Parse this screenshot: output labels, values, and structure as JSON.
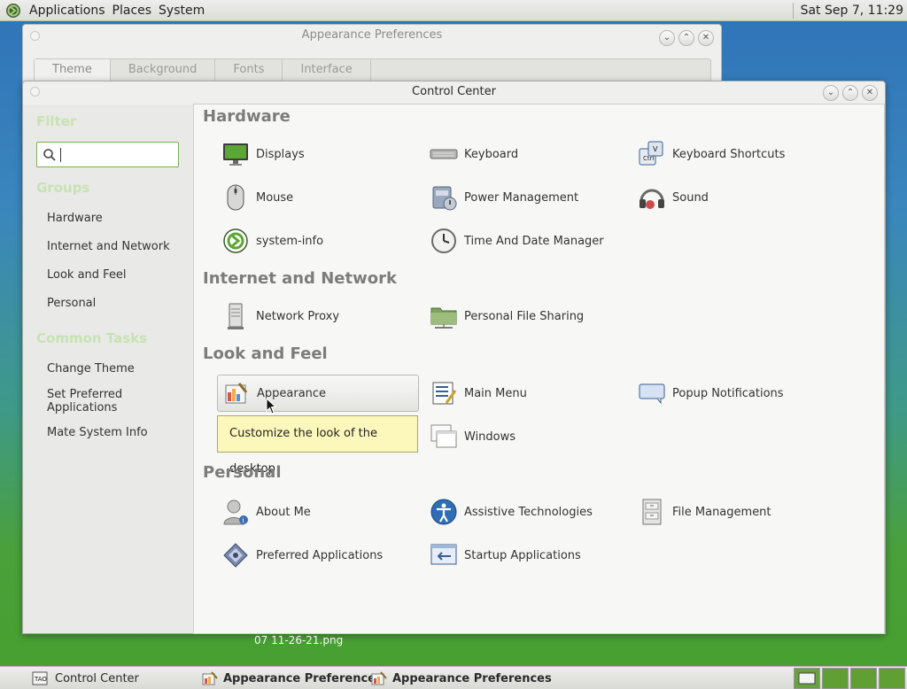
{
  "top_panel": {
    "menus": [
      "Applications",
      "Places",
      "System"
    ],
    "clock": "Sat Sep  7, 11:29"
  },
  "appearance_window": {
    "title": "Appearance Preferences",
    "tabs": [
      "Theme",
      "Background",
      "Fonts",
      "Interface"
    ]
  },
  "control_center": {
    "title": "Control Center",
    "sidebar": {
      "filter_heading": "Filter",
      "search_value": "",
      "groups_heading": "Groups",
      "groups": [
        "Hardware",
        "Internet and Network",
        "Look and Feel",
        "Personal"
      ],
      "tasks_heading": "Common Tasks",
      "tasks": [
        "Change Theme",
        "Set Preferred Applications",
        "Mate System Info"
      ]
    },
    "categories": [
      {
        "title": "Hardware",
        "items": [
          {
            "label": "Displays",
            "icon": "display-icon"
          },
          {
            "label": "Keyboard",
            "icon": "keyboard-icon"
          },
          {
            "label": "Keyboard Shortcuts",
            "icon": "keyboard-shortcuts-icon"
          },
          {
            "label": "Mouse",
            "icon": "mouse-icon"
          },
          {
            "label": "Power Management",
            "icon": "power-icon"
          },
          {
            "label": "Sound",
            "icon": "sound-icon"
          },
          {
            "label": "system-info",
            "icon": "mate-icon"
          },
          {
            "label": "Time And Date Manager",
            "icon": "clock-icon"
          }
        ]
      },
      {
        "title": "Internet and Network",
        "items": [
          {
            "label": "Network Proxy",
            "icon": "proxy-icon"
          },
          {
            "label": "Personal File Sharing",
            "icon": "folder-share-icon"
          }
        ]
      },
      {
        "title": "Look and Feel",
        "items": [
          {
            "label": "Appearance",
            "icon": "appearance-icon"
          },
          {
            "label": "Main Menu",
            "icon": "main-menu-icon"
          },
          {
            "label": "Popup Notifications",
            "icon": "notification-icon"
          },
          {
            "label": "Windows",
            "icon": "windows-icon"
          }
        ]
      },
      {
        "title": "Personal",
        "items": [
          {
            "label": "About Me",
            "icon": "user-icon"
          },
          {
            "label": "Assistive Technologies",
            "icon": "accessibility-icon"
          },
          {
            "label": "File Management",
            "icon": "file-cabinet-icon"
          },
          {
            "label": "Preferred Applications",
            "icon": "preferred-apps-icon"
          },
          {
            "label": "Startup Applications",
            "icon": "startup-icon"
          }
        ]
      }
    ],
    "tooltip": "Customize the look of the desktop"
  },
  "desktop": {
    "file_label": "07 11-26-21.png"
  },
  "taskbar": {
    "tasks": [
      "Control Center",
      "Appearance Preferences",
      "Appearance Preferences"
    ]
  },
  "colors": {
    "accent_green": "#79b052",
    "tooltip_bg": "#fcf8bc"
  }
}
